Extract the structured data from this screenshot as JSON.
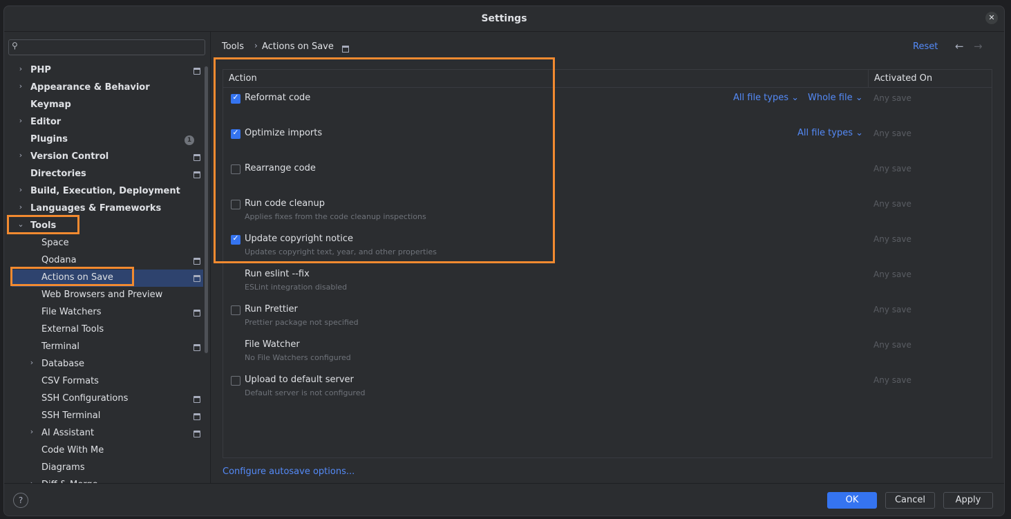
{
  "window": {
    "title": "Settings"
  },
  "search": {
    "placeholder": ""
  },
  "sidebar": {
    "items": [
      {
        "label": "PHP",
        "expand": "collapsed",
        "level": 0,
        "modified": true
      },
      {
        "label": "Appearance & Behavior",
        "expand": "collapsed",
        "level": 0,
        "modified": false
      },
      {
        "label": "Keymap",
        "expand": "none",
        "level": 0,
        "modified": false
      },
      {
        "label": "Editor",
        "expand": "collapsed",
        "level": 0,
        "modified": false
      },
      {
        "label": "Plugins",
        "expand": "none",
        "level": 0,
        "modified": false,
        "badge": "1"
      },
      {
        "label": "Version Control",
        "expand": "collapsed",
        "level": 0,
        "modified": true
      },
      {
        "label": "Directories",
        "expand": "none",
        "level": 0,
        "modified": true
      },
      {
        "label": "Build, Execution, Deployment",
        "expand": "collapsed",
        "level": 0,
        "modified": false
      },
      {
        "label": "Languages & Frameworks",
        "expand": "collapsed",
        "level": 0,
        "modified": false
      },
      {
        "label": "Tools",
        "expand": "expanded",
        "level": 0,
        "modified": false,
        "highlighted": true
      },
      {
        "label": "Space",
        "expand": "none",
        "level": 1,
        "modified": false
      },
      {
        "label": "Qodana",
        "expand": "none",
        "level": 1,
        "modified": true
      },
      {
        "label": "Actions on Save",
        "expand": "none",
        "level": 1,
        "modified": true,
        "selected": true,
        "highlighted": true
      },
      {
        "label": "Web Browsers and Preview",
        "expand": "none",
        "level": 1,
        "modified": false
      },
      {
        "label": "File Watchers",
        "expand": "none",
        "level": 1,
        "modified": true
      },
      {
        "label": "External Tools",
        "expand": "none",
        "level": 1,
        "modified": false
      },
      {
        "label": "Terminal",
        "expand": "none",
        "level": 1,
        "modified": true
      },
      {
        "label": "Database",
        "expand": "collapsed",
        "level": 1,
        "modified": false
      },
      {
        "label": "CSV Formats",
        "expand": "none",
        "level": 1,
        "modified": false
      },
      {
        "label": "SSH Configurations",
        "expand": "none",
        "level": 1,
        "modified": true
      },
      {
        "label": "SSH Terminal",
        "expand": "none",
        "level": 1,
        "modified": true
      },
      {
        "label": "AI Assistant",
        "expand": "collapsed",
        "level": 1,
        "modified": true
      },
      {
        "label": "Code With Me",
        "expand": "none",
        "level": 1,
        "modified": false
      },
      {
        "label": "Diagrams",
        "expand": "none",
        "level": 1,
        "modified": false
      },
      {
        "label": "Diff & Merge",
        "expand": "collapsed",
        "level": 1,
        "modified": false
      }
    ]
  },
  "breadcrumb": {
    "parent": "Tools",
    "separator": "›",
    "current": "Actions on Save"
  },
  "header": {
    "reset_label": "Reset",
    "back_icon": "←",
    "forward_icon": "→"
  },
  "table": {
    "columns": {
      "action": "Action",
      "activated_on": "Activated On"
    },
    "rows": [
      {
        "name": "Reformat code",
        "description": "",
        "checkbox": true,
        "checked": true,
        "links": [
          "All file types",
          "Whole file"
        ],
        "activated": "Any save"
      },
      {
        "name": "Optimize imports",
        "description": "",
        "checkbox": true,
        "checked": true,
        "links": [
          "All file types"
        ],
        "activated": "Any save"
      },
      {
        "name": "Rearrange code",
        "description": "",
        "checkbox": true,
        "checked": false,
        "links": [],
        "activated": "Any save"
      },
      {
        "name": "Run code cleanup",
        "description": "Applies fixes from the code cleanup inspections",
        "checkbox": true,
        "checked": false,
        "links": [],
        "activated": "Any save"
      },
      {
        "name": "Update copyright notice",
        "description": "Updates copyright text, year, and other properties",
        "checkbox": true,
        "checked": true,
        "links": [],
        "activated": "Any save"
      },
      {
        "name": "Run eslint --fix",
        "description": "ESLint integration disabled",
        "checkbox": false,
        "checked": false,
        "links": [],
        "activated": "Any save"
      },
      {
        "name": "Run Prettier",
        "description": "Prettier package not specified",
        "checkbox": true,
        "checked": false,
        "links": [],
        "activated": "Any save"
      },
      {
        "name": "File Watcher",
        "description": "No File Watchers configured",
        "checkbox": false,
        "checked": false,
        "links": [],
        "activated": "Any save"
      },
      {
        "name": "Upload to default server",
        "description": "Default server is not configured",
        "checkbox": true,
        "checked": false,
        "links": [],
        "activated": "Any save"
      }
    ]
  },
  "configure_link": "Configure autosave options...",
  "footer": {
    "help": "?",
    "ok": "OK",
    "cancel": "Cancel",
    "apply": "Apply"
  },
  "colors": {
    "accent": "#3574f0",
    "link": "#548af7",
    "highlight": "#f28a30",
    "selection": "#2e436e"
  }
}
